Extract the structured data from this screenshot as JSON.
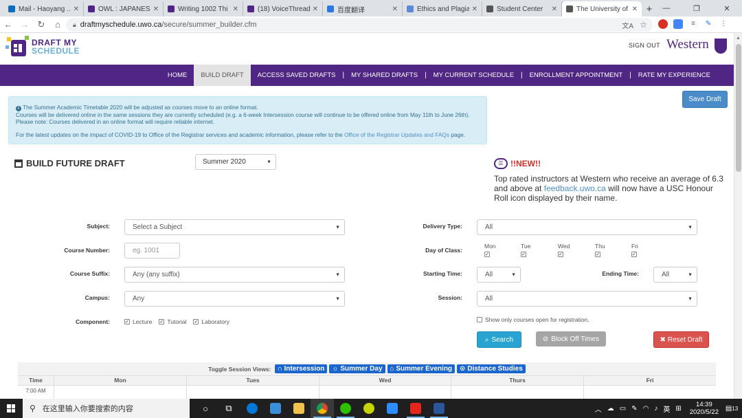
{
  "browser": {
    "tabs": [
      {
        "label": "Mail - Haoyang ...",
        "color": "#0f6cbd"
      },
      {
        "label": "OWL : JAPANESE",
        "color": "#4f2683"
      },
      {
        "label": "Writing 1002 Thi",
        "color": "#4f2683"
      },
      {
        "label": "(18) VoiceThread",
        "color": "#4f2683"
      },
      {
        "label": "百度翻译",
        "color": "#2b78e4"
      },
      {
        "label": "Ethics and Plagia",
        "color": "#5a8ad8"
      },
      {
        "label": "Student Center",
        "color": "#555555"
      },
      {
        "label": "The University of",
        "color": "#555555"
      }
    ],
    "url_host": "draftmyschedule.uwo.ca",
    "url_path": "/secure/summer_builder.cfm"
  },
  "header": {
    "logo_line1": "DRAFT MY",
    "logo_line2": "SCHEDULE",
    "signout": "SIGN OUT",
    "brand": "Western"
  },
  "nav": {
    "items": [
      "HOME",
      "BUILD DRAFT",
      "ACCESS SAVED DRAFTS",
      "MY SHARED DRAFTS",
      "MY CURRENT SCHEDULE",
      "ENROLLMENT APPOINTMENT",
      "RATE MY EXPERIENCE"
    ],
    "separator": "|"
  },
  "info": {
    "line1": "The Summer Academic Timetable 2020 will be adjusted as courses move to an online format.",
    "line2": "Courses will be delivered online in the same sessions they are currently scheduled (e.g. a 6-week Intersession course will continue to be offered online from May 11th to June 26th).",
    "line3": "Please note: Courses delivered in an online format will require reliable internet.",
    "line4_pre": "For the latest updates on the impact of COVID-19 to Office of the Registrar services and academic information, please refer to the ",
    "line4_link": "Office of the Registrar Updates and FAQs",
    "line4_post": " page."
  },
  "actions": {
    "save_draft": "Save Draft",
    "search": "Search",
    "block_off": "Block Off Times",
    "reset": "Reset Draft"
  },
  "build": {
    "title": "BUILD FUTURE DRAFT",
    "term": "Summer 2020"
  },
  "news": {
    "heading": "!!NEW!!",
    "pre": "Top rated instructors at Western who receive an average of 6.3 and above at ",
    "link": "feedback.uwo.ca",
    "post": " will now have a USC Honour Roll icon displayed by their name."
  },
  "form": {
    "subject_label": "Subject:",
    "subject_value": "Select a Subject",
    "number_label": "Course Number:",
    "number_placeholder": "eg. 1001",
    "suffix_label": "Course Suffix:",
    "suffix_value": "Any (any suffix)",
    "campus_label": "Campus:",
    "campus_value": "Any",
    "component_label": "Component:",
    "components": [
      "Lecture",
      "Tutorial",
      "Laboratory"
    ],
    "delivery_label": "Delivery Type:",
    "delivery_value": "All",
    "day_label": "Day of Class:",
    "days": [
      "Mon",
      "Tue",
      "Wed",
      "Thu",
      "Fri"
    ],
    "start_label": "Starting Time:",
    "start_value": "All",
    "end_label": "Ending Time:",
    "end_value": "All",
    "session_label": "Session:",
    "session_value": "All",
    "open_only": "Show only courses open for registration."
  },
  "calendar": {
    "toggle_label": "Toggle Session Views:",
    "sessions": [
      "Intersession",
      "Summer Day",
      "Summer Evening",
      "Distance Studies"
    ],
    "headers": [
      "Time",
      "Mon",
      "Tues",
      "Wed",
      "Thurs",
      "Fri"
    ],
    "first_time": "7:00 AM"
  },
  "taskbar": {
    "search_text": "在这里输入你要搜索的内容",
    "ime": "英",
    "time": "14:39",
    "date": "2020/5/22",
    "notifications": "13"
  }
}
